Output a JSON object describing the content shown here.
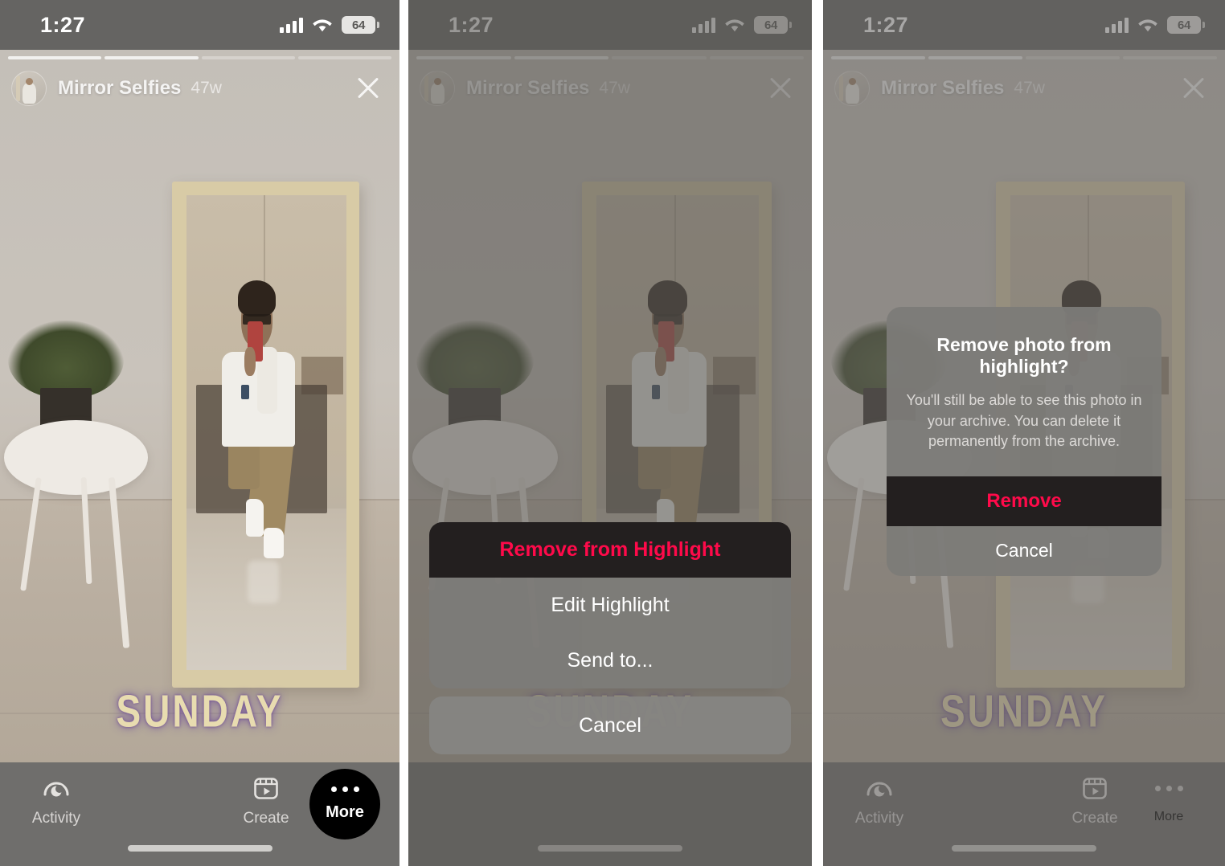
{
  "status_bar": {
    "time": "1:27",
    "battery_level": "64",
    "signal_icon": "cellular-signal-icon",
    "wifi_icon": "wifi-icon"
  },
  "story": {
    "highlight_name": "Mirror Selfies",
    "age": "47w",
    "caption": "SUNDAY",
    "close_icon": "close-icon",
    "avatar_icon": "highlight-avatar",
    "progress_segments": 4,
    "progress_completed": 2
  },
  "tabbar": {
    "activity_label": "Activity",
    "activity_icon": "activity-icon",
    "create_label": "Create",
    "create_icon": "create-reel-icon",
    "more_label": "More",
    "more_icon": "ellipsis-icon"
  },
  "action_sheet": {
    "items": [
      {
        "label": "Remove from Highlight",
        "style": "destructive"
      },
      {
        "label": "Edit Highlight",
        "style": "default"
      },
      {
        "label": "Send to...",
        "style": "default"
      }
    ],
    "cancel_label": "Cancel"
  },
  "alert": {
    "title": "Remove photo from highlight?",
    "message": "You'll still be able to see this photo in your archive. You can delete it permanently from the archive.",
    "confirm_label": "Remove",
    "cancel_label": "Cancel"
  },
  "colors": {
    "destructive_red": "#ff0a4a",
    "destructive_bg": "#231f1f",
    "sheet_bg": "#7c7b78",
    "tabbar_bg": "#6f6e6c",
    "caption_text": "#e8dcb0",
    "caption_shadow": "#694696"
  }
}
